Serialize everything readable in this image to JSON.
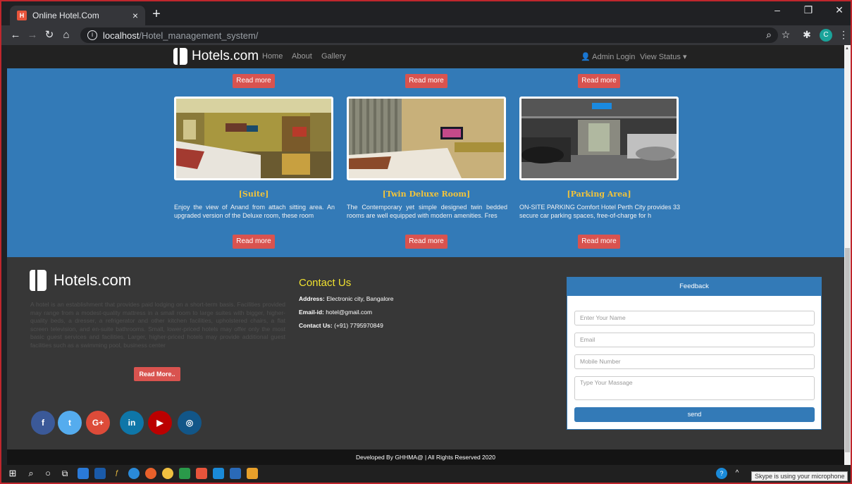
{
  "browser": {
    "tab_title": "Online Hotel.Com",
    "tab_close": "×",
    "new_tab": "+",
    "url_host": "localhost",
    "url_path": "/Hotel_management_system/",
    "profile_initial": "C",
    "win_min": "–",
    "win_max": "❐",
    "win_close": "✕"
  },
  "navbar": {
    "brand": "Hotels.com",
    "links": [
      "Home",
      "About",
      "Gallery"
    ],
    "admin": "Admin Login",
    "status": "View Status"
  },
  "top_buttons": [
    "Read more",
    "Read more",
    "Read more"
  ],
  "cards": [
    {
      "title": "[Suite]",
      "desc": "Enjoy the view of Anand from attach sitting area. An upgraded version of the Deluxe room, these room",
      "button": "Read more"
    },
    {
      "title": "[Twin Deluxe Room]",
      "desc": "The Contemporary yet simple designed twin bedded rooms are well equipped with modern amenities. Fres",
      "button": "Read more"
    },
    {
      "title": "[Parking Area]",
      "desc": "ON-SITE PARKING Comfort Hotel Perth City provides 33 secure car parking spaces, free-of-charge for h",
      "button": "Read more"
    }
  ],
  "footer": {
    "brand": "Hotels.com",
    "about": "A hotel is an establishment that provides paid lodging on a short-term basis. Facilities provided may range from a modest-quality mattress in a small room to large suites with bigger, higher-quality beds, a dresser, a refrigerator and other kitchen facilities, upholstered chairs, a flat screen television, and en-suite bathrooms. Small, lower-priced hotels may offer only the most basic guest services and facilities. Larger, higher-priced hotels may provide additional guest facilities such as a swimming pool, business center",
    "read_more": "Read More..",
    "social": [
      "f",
      "t",
      "G+",
      "in",
      "▶",
      "◎"
    ],
    "contact_title": "Contact Us",
    "address_label": "Address:",
    "address": "Electronic city, Bangalore",
    "email_label": "Email-id:",
    "email": "hotel@gmail.com",
    "phone_label": "Contact Us:",
    "phone": "(+91) 7795970849"
  },
  "feedback": {
    "title": "Feedback",
    "name_placeholder": "Enter Your Name",
    "email_placeholder": "Email",
    "mobile_placeholder": "Mobile Number",
    "message_placeholder": "Type Your Massage",
    "send": "send"
  },
  "copyright": "Developed By GHHMA@ | All Rights Reserved 2020",
  "taskbar": {
    "toast": "Skype is using your microphone"
  },
  "colors": {
    "page_bg": "#337ab7",
    "footer_bg": "#373737",
    "accent_red": "#d9534f",
    "title_gold": "#f0c33c"
  }
}
